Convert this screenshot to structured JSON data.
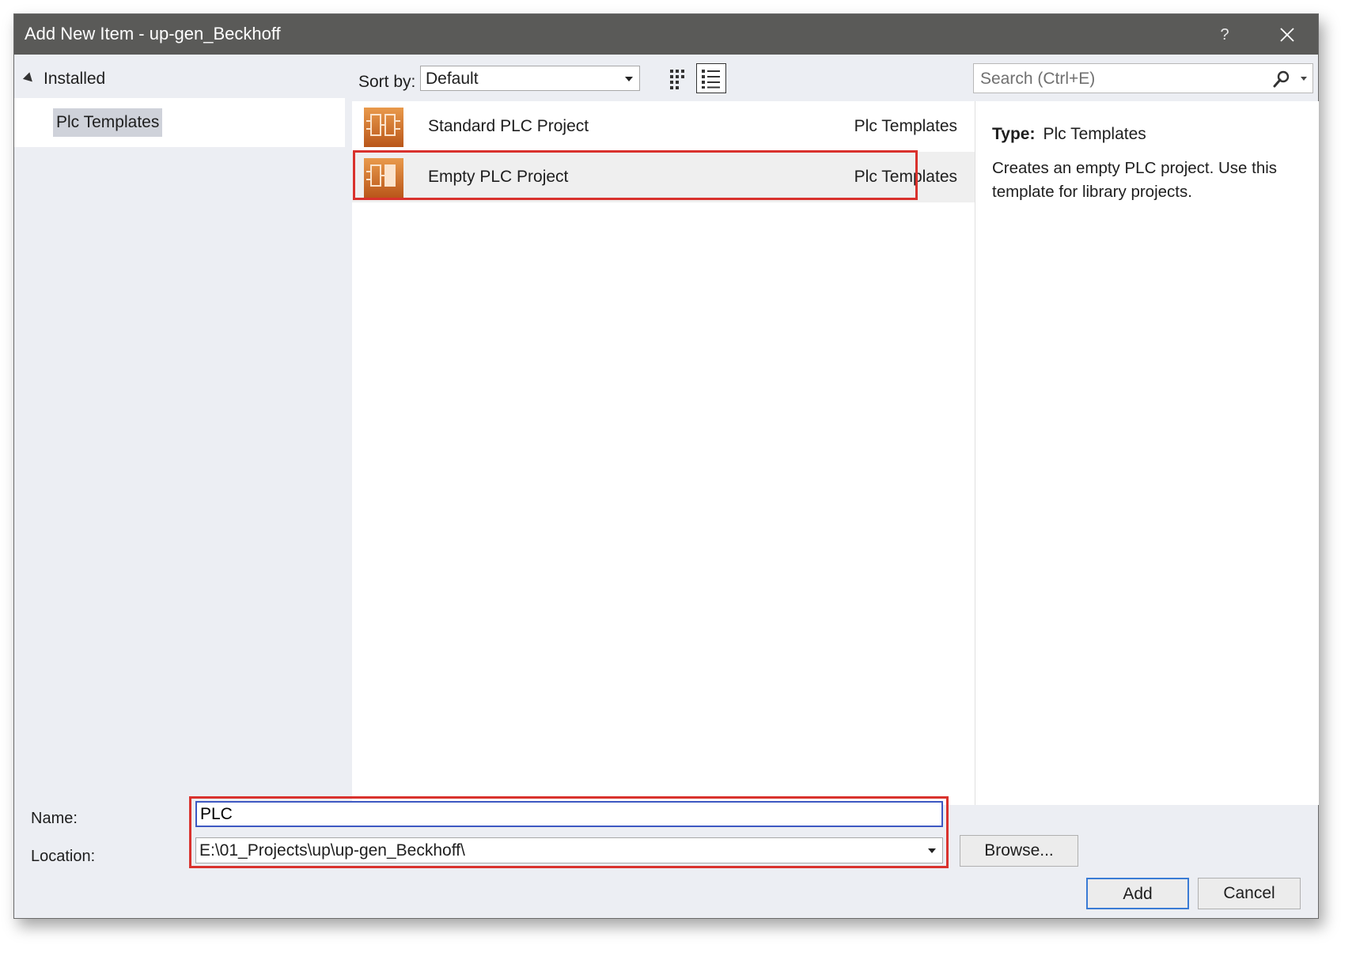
{
  "window": {
    "title": "Add New Item - up-gen_Beckhoff",
    "help_label": "?",
    "close_icon": "close-icon"
  },
  "tree": {
    "header": "Installed",
    "items": [
      {
        "label": "Plc Templates",
        "selected": true
      }
    ]
  },
  "toolbar": {
    "sort_label": "Sort by:",
    "sort_value": "Default",
    "view_icons": [
      "grid-view-icon",
      "list-view-icon"
    ],
    "active_view": "list"
  },
  "search": {
    "placeholder": "Search (Ctrl+E)",
    "value": ""
  },
  "templates": [
    {
      "name": "Standard PLC Project",
      "category": "Plc Templates",
      "selected": false
    },
    {
      "name": "Empty PLC Project",
      "category": "Plc Templates",
      "selected": true
    }
  ],
  "details": {
    "type_label": "Type:",
    "type_value": "Plc Templates",
    "description": "Creates an empty PLC project. Use this template for library projects."
  },
  "form": {
    "name_label": "Name:",
    "name_value": "PLC",
    "location_label": "Location:",
    "location_value": "E:\\01_Projects\\up\\up-gen_Beckhoff\\",
    "browse_label": "Browse...",
    "add_label": "Add",
    "cancel_label": "Cancel"
  },
  "colors": {
    "titlebar": "#5a5a58",
    "dialog_bg": "#eceef3",
    "highlight_red": "#d9322d",
    "focus_blue": "#3d58c2",
    "plc_icon_orange": "#d9782a"
  }
}
